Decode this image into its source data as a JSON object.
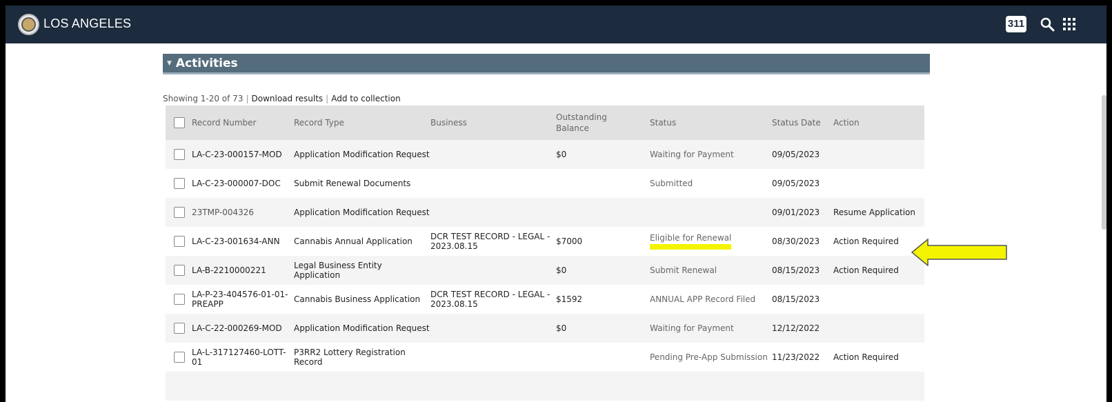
{
  "header": {
    "brand": "LOS ANGELES",
    "badge_311": "311",
    "logo_icon": "city-seal-icon",
    "search_icon": "search-icon",
    "apps_icon": "grid-icon",
    "background_color": "#1c2b3d"
  },
  "section": {
    "title": "Activities",
    "bar_color": "#546c7c"
  },
  "results": {
    "showing": "Showing 1-20 of 73",
    "download": "Download results",
    "add_collection": "Add to collection"
  },
  "table": {
    "headers": {
      "record_number": "Record Number",
      "record_type": "Record Type",
      "business": "Business",
      "outstanding_balance": "Outstanding Balance",
      "status": "Status",
      "status_date": "Status Date",
      "action": "Action"
    },
    "rows": [
      {
        "record_number": "LA-C-23-000157-MOD",
        "record_type": "Application Modification Request",
        "business": "",
        "balance": "$0",
        "status": "Waiting for Payment",
        "status_date": "09/05/2023",
        "action": ""
      },
      {
        "record_number": "LA-C-23-000007-DOC",
        "record_type": "Submit Renewal Documents",
        "business": "",
        "balance": "",
        "status": "Submitted",
        "status_date": "09/05/2023",
        "action": ""
      },
      {
        "record_number": "23TMP-004326",
        "record_type": "Application Modification Request",
        "business": "",
        "balance": "",
        "status": "",
        "status_date": "09/01/2023",
        "action": "Resume Application"
      },
      {
        "record_number": "LA-C-23-001634-ANN",
        "record_type": "Cannabis Annual Application",
        "business": "DCR TEST RECORD - LEGAL - 2023.08.15",
        "balance": "$7000",
        "status": "Eligible for Renewal",
        "status_date": "08/30/2023",
        "action": "Action Required"
      },
      {
        "record_number": "LA-B-2210000221",
        "record_type": "Legal Business Entity Application",
        "business": "",
        "balance": "$0",
        "status": "Submit Renewal",
        "status_date": "08/15/2023",
        "action": "Action Required"
      },
      {
        "record_number": "LA-P-23-404576-01-01-PREAPP",
        "record_type": "Cannabis Business Application",
        "business": "DCR TEST RECORD - LEGAL - 2023.08.15",
        "balance": "$1592",
        "status": "ANNUAL APP Record Filed",
        "status_date": "08/15/2023",
        "action": ""
      },
      {
        "record_number": "LA-C-22-000269-MOD",
        "record_type": "Application Modification Request",
        "business": "",
        "balance": "$0",
        "status": "Waiting for Payment",
        "status_date": "12/12/2022",
        "action": ""
      },
      {
        "record_number": "LA-L-317127460-LOTT-01",
        "record_type": "P3RR2 Lottery Registration Record",
        "business": "",
        "balance": "",
        "status": "Pending Pre-App Submission",
        "status_date": "11/23/2022",
        "action": "Action Required"
      }
    ]
  },
  "annotation": {
    "highlight_color": "#f4f400",
    "arrow_color": "#f4f400"
  }
}
